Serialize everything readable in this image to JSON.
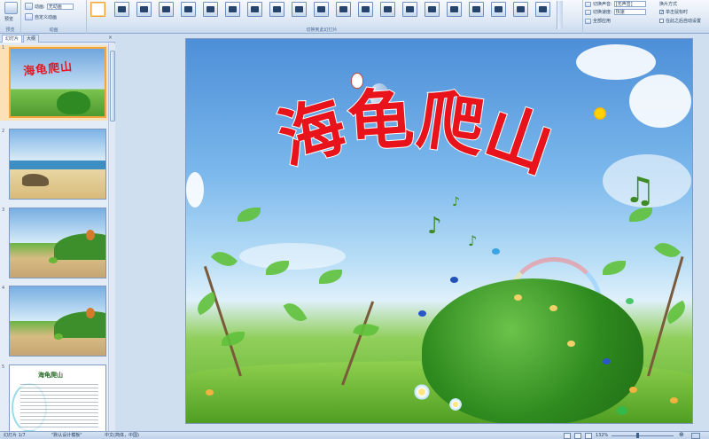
{
  "ribbon": {
    "preview_label": "预览",
    "preview_group_label": "预览",
    "animate_label": "动画:",
    "animate_value": "无动画",
    "custom_animation_label": "自定义动画",
    "animation_group_label": "动画",
    "transition_group_label": "切换到此幻灯片",
    "transition_sound_label": "切换声音:",
    "transition_sound_value": "[无声音]",
    "transition_speed_label": "切换速度:",
    "transition_speed_value": "快速",
    "apply_all_label": "全部应用",
    "advance_label": "换片方式",
    "on_click_label": "单击鼠标时",
    "auto_after_label": "在此之后自动设置",
    "on_click_checked": true
  },
  "left_panel": {
    "tab_slides": "幻灯片",
    "tab_outline": "大纲",
    "close_label": "×",
    "thumbnails": [
      {
        "number": "1",
        "title": "海龟爬山",
        "selected": true
      },
      {
        "number": "2",
        "selected": false
      },
      {
        "number": "3",
        "selected": false
      },
      {
        "number": "4",
        "selected": false
      },
      {
        "number": "5",
        "title": "海龟爬山",
        "selected": false
      }
    ]
  },
  "slide": {
    "title": "海龟爬山",
    "title_color": "#e8131b"
  },
  "status": {
    "slide_indicator": "幻灯片 1/7",
    "theme": "\"默认设计模板\"",
    "language": "中文(简体，中国)",
    "zoom": "132%"
  },
  "colors": {
    "accent": "#f3a53f",
    "ribbon_bg": "#dbe6f4",
    "title_red": "#e8131b"
  }
}
